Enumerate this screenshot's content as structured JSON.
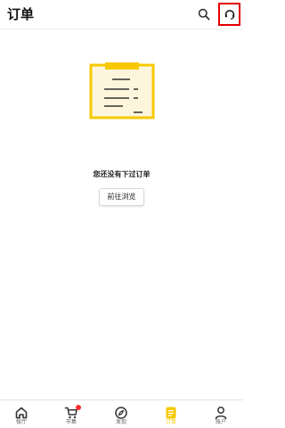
{
  "header": {
    "title": "订单",
    "search_icon": "search-icon",
    "service_icon": "headset-icon",
    "highlight_color": "#e00000"
  },
  "empty_state": {
    "message": "您还没有下过订单",
    "button_label": "前往浏览",
    "illustration": "clipboard-icon",
    "accent_color": "#f7c900",
    "paper_color": "#fdf6dc"
  },
  "bottom_nav": {
    "items": [
      {
        "label": "餐厅",
        "icon": "home-icon",
        "active": false
      },
      {
        "label": "市集",
        "icon": "cart-icon",
        "active": false,
        "badge": true
      },
      {
        "label": "发现",
        "icon": "compass-icon",
        "active": false
      },
      {
        "label": "订单",
        "icon": "order-icon",
        "active": true
      },
      {
        "label": "账户",
        "icon": "user-icon",
        "active": false
      }
    ],
    "active_color": "#f7c900",
    "inactive_color": "#666666",
    "badge_color": "#ff2d2d"
  }
}
